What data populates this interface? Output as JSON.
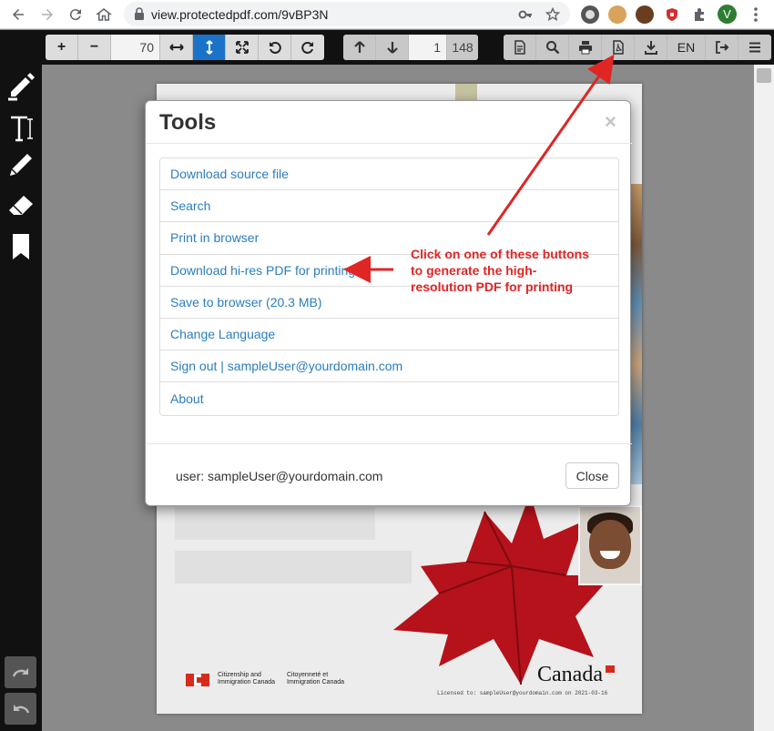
{
  "browser": {
    "url": "view.protectedpdf.com/9vBP3N",
    "avatar_letter": "V",
    "extensions": [
      "circle-ext-icon",
      "cookie-ext-icon",
      "cookie-dark-ext-icon",
      "shield-ext-icon",
      "puzzle-icon"
    ]
  },
  "toolbar": {
    "zoom_in": "+",
    "zoom_out": "−",
    "zoom_value": "70",
    "current_page": "1",
    "total_pages": "148",
    "language": "EN",
    "active_color": "#1a73c8"
  },
  "document": {
    "dept_en": "Citizenship and Immigration Canada",
    "dept_fr": "Citoyenneté et Immigration Canada",
    "wordmark": "Canada",
    "licensed": "Licensed to: sampleUser@yourdomain.com on 2021-03-16"
  },
  "modal": {
    "title": "Tools",
    "close_x": "×",
    "items": [
      "Download source file",
      "Search",
      "Print in browser",
      "Download hi-res PDF for printing",
      "Save to browser (20.3 MB)",
      "Change Language",
      "Sign out | sampleUser@yourdomain.com",
      "About"
    ],
    "user_label": "user: sampleUser@yourdomain.com",
    "close_button": "Close",
    "link_color": "#2a7dbf"
  },
  "annotation": {
    "text": "Click on one of these buttons to generate the high-resolution PDF for printing",
    "color": "#e02525"
  }
}
